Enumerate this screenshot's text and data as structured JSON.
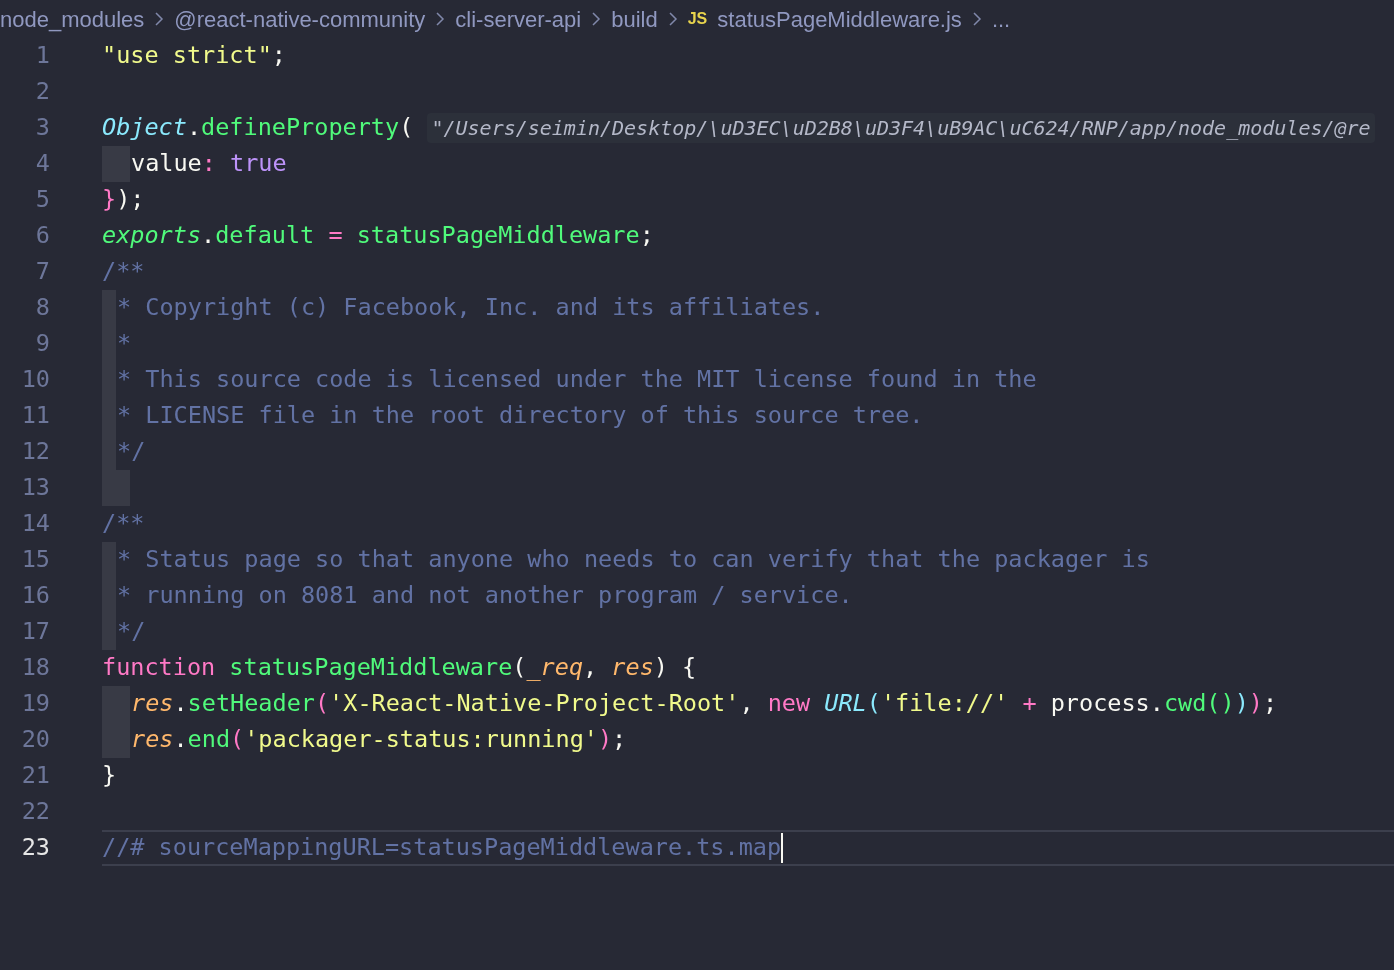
{
  "breadcrumbs": [
    {
      "kind": "folder",
      "label": "node_modules"
    },
    {
      "kind": "folder",
      "label": "@react-native-community"
    },
    {
      "kind": "folder",
      "label": "cli-server-api"
    },
    {
      "kind": "folder",
      "label": "build"
    },
    {
      "kind": "file",
      "badge": "JS",
      "label": "statusPageMiddleware.js"
    },
    {
      "kind": "more",
      "label": "..."
    }
  ],
  "lines": [
    {
      "number": "1",
      "tokens": [
        {
          "kind": "string",
          "text": "\"use strict\""
        },
        {
          "kind": "plain",
          "text": ";"
        }
      ]
    },
    {
      "number": "2"
    },
    {
      "number": "3",
      "folded": true,
      "tokens": [
        {
          "kind": "class",
          "text": "Object"
        },
        {
          "kind": "plain",
          "text": "."
        },
        {
          "kind": "func",
          "text": "defineProperty"
        },
        {
          "kind": "plain",
          "text": "( "
        }
      ],
      "hint": "\"/Users/seimin/Desktop/\\uD3EC\\uD2B8\\uD3F4\\uB9AC\\uC624/RNP/app/node_modules/@re"
    },
    {
      "number": "4",
      "guide": true,
      "tokens": [
        {
          "kind": "plain",
          "text": "value"
        },
        {
          "kind": "keyword",
          "text": ": "
        },
        {
          "kind": "bool",
          "text": "true"
        }
      ]
    },
    {
      "number": "5",
      "tokens": [
        {
          "kind": "keyword",
          "text": "}"
        },
        {
          "kind": "plain",
          "text": ");"
        }
      ]
    },
    {
      "number": "6",
      "tokens": [
        {
          "kind": "variable",
          "text": "exports"
        },
        {
          "kind": "plain",
          "text": "."
        },
        {
          "kind": "func",
          "text": "default"
        },
        {
          "kind": "keyword",
          "text": " = "
        },
        {
          "kind": "func",
          "text": "statusPageMiddleware"
        },
        {
          "kind": "plain",
          "text": ";"
        }
      ]
    },
    {
      "number": "7",
      "tokens": [
        {
          "kind": "comment",
          "text": "/**"
        }
      ]
    },
    {
      "number": "8",
      "guide": true,
      "tokens": [
        {
          "kind": "comment",
          "text": "* Copyright (c) Facebook, Inc. and its affiliates."
        }
      ]
    },
    {
      "number": "9",
      "guide": true,
      "tokens": [
        {
          "kind": "comment",
          "text": "*"
        }
      ]
    },
    {
      "number": "10",
      "guide": true,
      "tokens": [
        {
          "kind": "comment",
          "text": "* This source code is licensed under the MIT license found in the"
        }
      ]
    },
    {
      "number": "11",
      "guide": true,
      "tokens": [
        {
          "kind": "comment",
          "text": "* LICENSE file in the root directory of this source tree."
        }
      ]
    },
    {
      "number": "12",
      "guide": true,
      "tokens": [
        {
          "kind": "comment",
          "text": "*/"
        }
      ]
    },
    {
      "number": "13",
      "guide": true
    },
    {
      "number": "14",
      "tokens": [
        {
          "kind": "comment",
          "text": "/**"
        }
      ]
    },
    {
      "number": "15",
      "guide": true,
      "tokens": [
        {
          "kind": "comment",
          "text": "* Status page so that anyone who needs to can verify that the packager is"
        }
      ]
    },
    {
      "number": "16",
      "guide": true,
      "tokens": [
        {
          "kind": "comment",
          "text": "* running on 8081 and not another program / service."
        }
      ]
    },
    {
      "number": "17",
      "guide": true,
      "tokens": [
        {
          "kind": "comment",
          "text": "*/"
        }
      ]
    },
    {
      "number": "18",
      "tokens": [
        {
          "kind": "keyword",
          "text": "function "
        },
        {
          "kind": "func",
          "text": "statusPageMiddleware"
        },
        {
          "kind": "plain",
          "text": "("
        },
        {
          "kind": "param",
          "text": "_req"
        },
        {
          "kind": "plain",
          "text": ", "
        },
        {
          "kind": "param",
          "text": "res"
        },
        {
          "kind": "plain",
          "text": ") {"
        }
      ]
    },
    {
      "number": "19",
      "guide": true,
      "tokens": [
        {
          "kind": "param",
          "text": "res"
        },
        {
          "kind": "plain",
          "text": "."
        },
        {
          "kind": "func",
          "text": "setHeader"
        },
        {
          "kind": "keyword",
          "text": "("
        },
        {
          "kind": "string",
          "text": "'X-React-Native-Project-Root'"
        },
        {
          "kind": "plain",
          "text": ", "
        },
        {
          "kind": "keyword",
          "text": "new "
        },
        {
          "kind": "class",
          "text": "URL"
        },
        {
          "kind": "bracket",
          "text": "("
        },
        {
          "kind": "string",
          "text": "'file://'"
        },
        {
          "kind": "keyword",
          "text": " + "
        },
        {
          "kind": "plain",
          "text": "process."
        },
        {
          "kind": "func",
          "text": "cwd()"
        },
        {
          "kind": "bracket",
          "text": ")"
        },
        {
          "kind": "keyword",
          "text": ")"
        },
        {
          "kind": "plain",
          "text": ";"
        }
      ]
    },
    {
      "number": "20",
      "guide": true,
      "tokens": [
        {
          "kind": "param",
          "text": "res"
        },
        {
          "kind": "plain",
          "text": "."
        },
        {
          "kind": "func",
          "text": "end"
        },
        {
          "kind": "keyword",
          "text": "("
        },
        {
          "kind": "string",
          "text": "'packager-status:running'"
        },
        {
          "kind": "keyword",
          "text": ")"
        },
        {
          "kind": "plain",
          "text": ";"
        }
      ]
    },
    {
      "number": "21",
      "tokens": [
        {
          "kind": "plain",
          "text": "}"
        }
      ]
    },
    {
      "number": "22"
    },
    {
      "number": "23",
      "current": true,
      "tokens": [
        {
          "kind": "comment",
          "text": "//# sourceMappingURL=statusPageMiddleware.ts.map"
        }
      ]
    }
  ]
}
